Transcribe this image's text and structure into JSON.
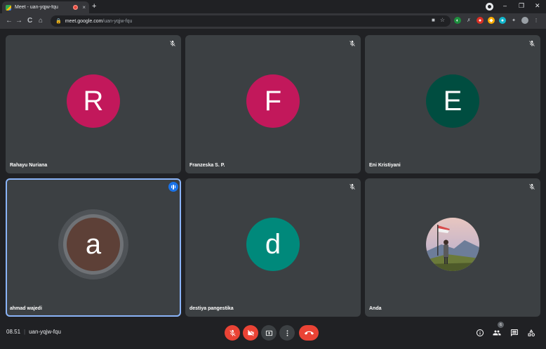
{
  "browser": {
    "tab_title": "Meet - uan-yqjw-fqu",
    "tab_close": "×",
    "new_tab": "+",
    "url_host": "meet.google.com",
    "url_path": "/uan-yqjw-fqu",
    "win_min": "–",
    "win_max": "❐",
    "win_close": "✕",
    "back": "←",
    "forward": "→",
    "reload": "C",
    "home": "⌂"
  },
  "participants": [
    {
      "name": "Rahayu Nuriana",
      "initial": "R",
      "color": "#c2185b",
      "muted": true
    },
    {
      "name": "Franzeska S. P.",
      "initial": "F",
      "color": "#c2185b",
      "muted": true
    },
    {
      "name": "Eni Kristiyani",
      "initial": "E",
      "color": "#004d40",
      "muted": true
    },
    {
      "name": "ahmad wajedi",
      "initial": "a",
      "color": "#5d4037",
      "muted": false,
      "speaking": true
    },
    {
      "name": "destiya pangestika",
      "initial": "d",
      "color": "#00897b",
      "muted": true
    },
    {
      "name": "Anda",
      "initial": "",
      "color": "#9e9e9e",
      "muted": true,
      "photo": true
    }
  ],
  "meeting": {
    "time": "08.51",
    "separator": "|",
    "code": "uan-yqjw-fqu",
    "participant_count": "6"
  },
  "colors": {
    "accent": "#8ab4f8",
    "danger": "#ea4335",
    "tile_bg": "#3c4043"
  }
}
